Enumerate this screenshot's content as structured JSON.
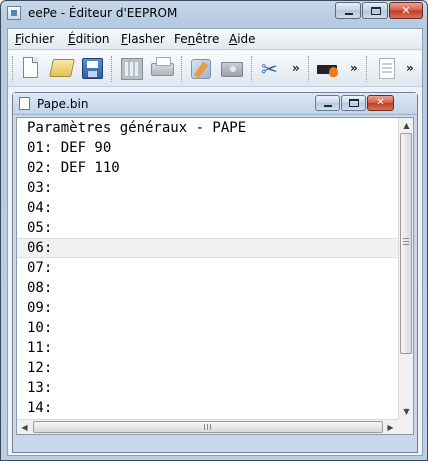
{
  "window": {
    "title": "eePe - Éditeur d'EEPROM",
    "minimize_glyph": "",
    "maximize_glyph": "",
    "close_glyph": "✕"
  },
  "menu": {
    "items": [
      {
        "name": "menu-fichier",
        "accel": "F",
        "rest": "ichier"
      },
      {
        "name": "menu-edition",
        "accel": "É",
        "rest": "dition"
      },
      {
        "name": "menu-flasher",
        "accel": "F",
        "rest": "lasher"
      },
      {
        "name": "menu-fenetre",
        "accel": "n",
        "pre": "Fe",
        "rest": "être"
      },
      {
        "name": "menu-aide",
        "accel": "A",
        "rest": "ide"
      }
    ]
  },
  "toolbar": {
    "overflow_glyph": "»",
    "icons": [
      "new-document-icon",
      "open-folder-icon",
      "save-icon",
      "calculator-icon",
      "print-icon",
      "generate-icon",
      "disk-icon",
      "cut-icon",
      "eeprom-chip-icon",
      "document-icon"
    ]
  },
  "child_window": {
    "title": "Pape.bin",
    "close_glyph": "✕"
  },
  "editor": {
    "header": "Paramètres généraux - PAPE",
    "current_line_index": 6,
    "lines": [
      "01: DEF 90",
      "02: DEF 110",
      "03:",
      "04:",
      "05:",
      "06:",
      "07:",
      "08:",
      "09:",
      "10:",
      "11:",
      "12:",
      "13:",
      "14:"
    ]
  },
  "scrollbars": {
    "up_glyph": "▲",
    "down_glyph": "▼",
    "left_glyph": "◀",
    "right_glyph": "▶"
  },
  "colors": {
    "titlebar": "#b9cfe5",
    "close_button": "#c43a22",
    "current_line": "#f1f1f1"
  }
}
